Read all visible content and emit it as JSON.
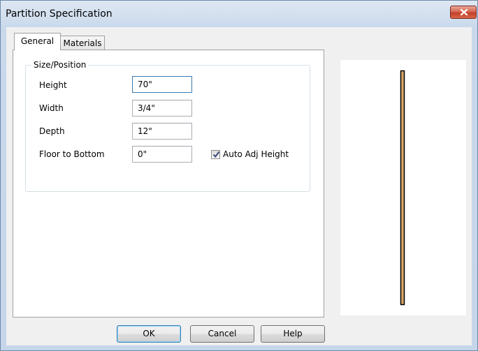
{
  "window": {
    "title": "Partition Specification",
    "close_icon": "close-icon"
  },
  "tabs": [
    {
      "label": "General",
      "selected": true
    },
    {
      "label": "Materials",
      "selected": false
    }
  ],
  "size_position": {
    "group_label": "Size/Position",
    "fields": [
      {
        "label": "Height",
        "value": "70\""
      },
      {
        "label": "Width",
        "value": "3/4\""
      },
      {
        "label": "Depth",
        "value": "12\""
      },
      {
        "label": "Floor to Bottom",
        "value": "0\""
      }
    ],
    "auto_adj_height": {
      "label": "Auto Adj Height",
      "checked": true
    }
  },
  "preview": {
    "partition_color": "#d9a868",
    "outline_color": "#000000"
  },
  "buttons": {
    "ok": "OK",
    "cancel": "Cancel",
    "help": "Help"
  }
}
